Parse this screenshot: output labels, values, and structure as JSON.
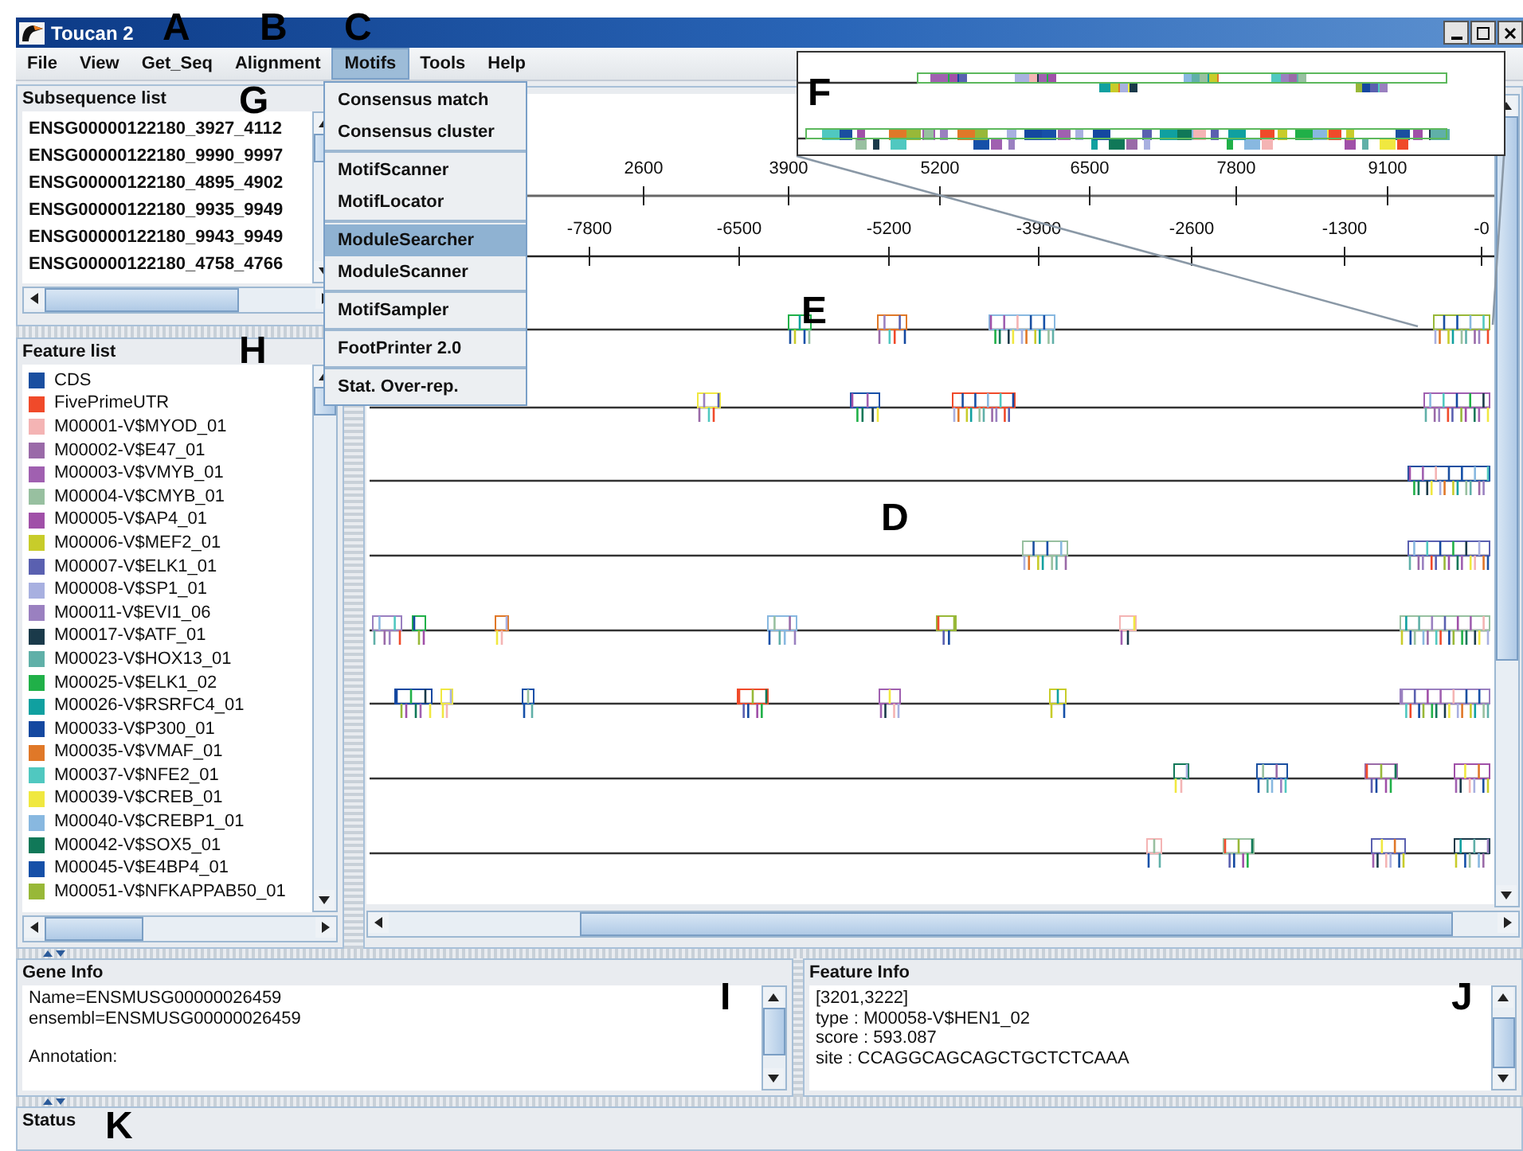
{
  "window": {
    "title": "Toucan 2"
  },
  "menu": [
    {
      "label": "File",
      "selected": false
    },
    {
      "label": "View",
      "selected": false
    },
    {
      "label": "Get_Seq",
      "selected": false
    },
    {
      "label": "Alignment",
      "selected": false
    },
    {
      "label": "Motifs",
      "selected": true
    },
    {
      "label": "Tools",
      "selected": false
    },
    {
      "label": "Help",
      "selected": false
    }
  ],
  "motifs_menu": [
    {
      "label": "Consensus match",
      "separator_before": false,
      "selected": false
    },
    {
      "label": "Consensus cluster",
      "separator_before": false,
      "selected": false
    },
    {
      "label": "MotifScanner",
      "separator_before": true,
      "selected": false
    },
    {
      "label": "MotifLocator",
      "separator_before": false,
      "selected": false
    },
    {
      "label": "ModuleSearcher",
      "separator_before": true,
      "selected": true
    },
    {
      "label": "ModuleScanner",
      "separator_before": false,
      "selected": false
    },
    {
      "label": "MotifSampler",
      "separator_before": true,
      "selected": false
    },
    {
      "label": "FootPrinter 2.0",
      "separator_before": true,
      "selected": false
    },
    {
      "label": "Stat. Over-rep.",
      "separator_before": true,
      "selected": false
    }
  ],
  "subsequence_list": {
    "title": "Subsequence list",
    "items": [
      "ENSG00000122180_3927_4112",
      "ENSG00000122180_9990_9997",
      "ENSG00000122180_4895_4902",
      "ENSG00000122180_9935_9949",
      "ENSG00000122180_9943_9949",
      "ENSG00000122180_4758_4766"
    ]
  },
  "feature_list": {
    "title": "Feature list",
    "items": [
      {
        "label": "CDS",
        "color": "#1a4fa0"
      },
      {
        "label": "FivePrimeUTR",
        "color": "#f04a2a"
      },
      {
        "label": "M00001-V$MYOD_01",
        "color": "#f4b4b4"
      },
      {
        "label": "M00002-V$E47_01",
        "color": "#9a6aa8"
      },
      {
        "label": "M00003-V$VMYB_01",
        "color": "#a060b0"
      },
      {
        "label": "M00004-V$CMYB_01",
        "color": "#98c0a0"
      },
      {
        "label": "M00005-V$AP4_01",
        "color": "#a050a8"
      },
      {
        "label": "M00006-V$MEF2_01",
        "color": "#c8cc2a"
      },
      {
        "label": "M00007-V$ELK1_01",
        "color": "#5a60b0"
      },
      {
        "label": "M00008-V$SP1_01",
        "color": "#a8b0e0"
      },
      {
        "label": "M00011-V$EVI1_06",
        "color": "#9a80c0"
      },
      {
        "label": "M00017-V$ATF_01",
        "color": "#1a3a4a"
      },
      {
        "label": "M00023-V$HOX13_01",
        "color": "#60b0a8"
      },
      {
        "label": "M00025-V$ELK1_02",
        "color": "#20b048"
      },
      {
        "label": "M00026-V$RSRFC4_01",
        "color": "#10a0a0"
      },
      {
        "label": "M00033-V$P300_01",
        "color": "#1448a0"
      },
      {
        "label": "M00035-V$VMAF_01",
        "color": "#e07828"
      },
      {
        "label": "M00037-V$NFE2_01",
        "color": "#50c8c0"
      },
      {
        "label": "M00039-V$CREB_01",
        "color": "#f0e840"
      },
      {
        "label": "M00040-V$CREBP1_01",
        "color": "#88b8e0"
      },
      {
        "label": "M00042-V$SOX5_01",
        "color": "#107858"
      },
      {
        "label": "M00045-V$E4BP4_01",
        "color": "#1650a8"
      },
      {
        "label": "M00051-V$NFKAPPAB50_01",
        "color": "#98b838"
      }
    ]
  },
  "sequence_view": {
    "top_ruler": [
      "2600",
      "3900",
      "5200",
      "6500",
      "7800",
      "9100"
    ],
    "bottom_ruler": [
      "-7800",
      "-6500",
      "-5200",
      "-3900",
      "-2600",
      "-1300",
      "-0"
    ]
  },
  "gene_info": {
    "title": "Gene Info",
    "lines": [
      "Name=ENSMUSG00000026459",
      "ensembl=ENSMUSG00000026459"
    ],
    "annotation": "Annotation:"
  },
  "feature_info": {
    "title": "Feature Info",
    "lines": [
      "[3201,3222]",
      "type : M00058-V$HEN1_02",
      "score : 593.087",
      "site : CCAGGCAGCAGCTGCTCTCAAA"
    ]
  },
  "status": {
    "title": "Status"
  },
  "callouts": [
    "A",
    "B",
    "C",
    "G",
    "H",
    "F",
    "E",
    "D",
    "I",
    "J",
    "K"
  ]
}
